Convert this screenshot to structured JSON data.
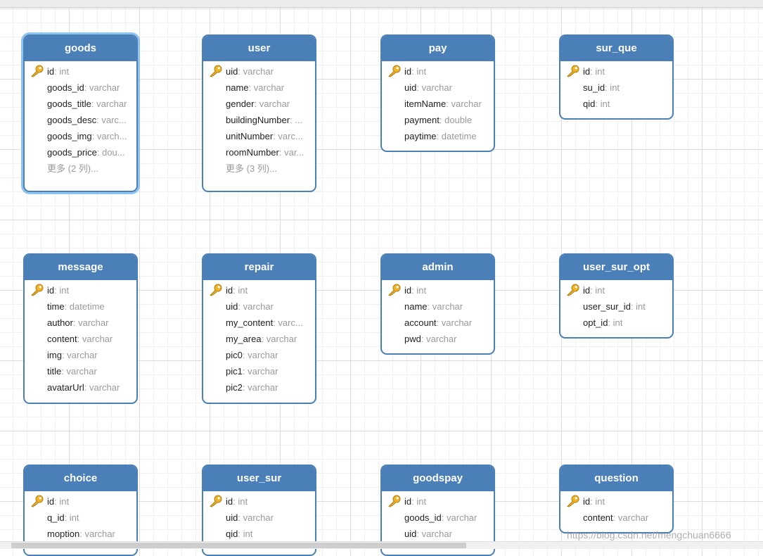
{
  "colors": {
    "header": "#4a7fb7",
    "type_text": "#9a9a9a",
    "key_icon": "#f0b428",
    "selection": "#8fc4f0"
  },
  "toolbar": {
    "status": ""
  },
  "tables": [
    {
      "name": "goods",
      "selected": true,
      "columns": [
        {
          "name": "id",
          "type": ": int",
          "pk": true
        },
        {
          "name": "goods_id",
          "type": ": varchar"
        },
        {
          "name": "goods_title",
          "type": ": varchar"
        },
        {
          "name": "goods_desc",
          "type": ": varc..."
        },
        {
          "name": "goods_img",
          "type": ": varch..."
        },
        {
          "name": "goods_price",
          "type": ": dou..."
        }
      ],
      "more": "更多 (2 列)..."
    },
    {
      "name": "user",
      "columns": [
        {
          "name": "uid",
          "type": ": varchar",
          "pk": true
        },
        {
          "name": "name",
          "type": ": varchar"
        },
        {
          "name": "gender",
          "type": ": varchar"
        },
        {
          "name": "buildingNumber",
          "type": ": ..."
        },
        {
          "name": "unitNumber",
          "type": ": varc..."
        },
        {
          "name": "roomNumber",
          "type": ": var..."
        }
      ],
      "more": "更多 (3 列)..."
    },
    {
      "name": "pay",
      "columns": [
        {
          "name": "id",
          "type": ": int",
          "pk": true
        },
        {
          "name": "uid",
          "type": ": varchar"
        },
        {
          "name": "itemName",
          "type": ": varchar"
        },
        {
          "name": "payment",
          "type": ": double"
        },
        {
          "name": "paytime",
          "type": ": datetime"
        }
      ]
    },
    {
      "name": "sur_que",
      "columns": [
        {
          "name": "id",
          "type": ": int",
          "pk": true
        },
        {
          "name": "su_id",
          "type": ": int"
        },
        {
          "name": "qid",
          "type": ": int"
        }
      ]
    },
    {
      "name": "message",
      "columns": [
        {
          "name": "id",
          "type": ": int",
          "pk": true
        },
        {
          "name": "time",
          "type": ": datetime"
        },
        {
          "name": "author",
          "type": ": varchar"
        },
        {
          "name": "content",
          "type": ": varchar"
        },
        {
          "name": "img",
          "type": ": varchar"
        },
        {
          "name": "title",
          "type": ": varchar"
        },
        {
          "name": "avatarUrl",
          "type": ": varchar"
        }
      ]
    },
    {
      "name": "repair",
      "columns": [
        {
          "name": "id",
          "type": ": int",
          "pk": true
        },
        {
          "name": "uid",
          "type": ": varchar"
        },
        {
          "name": "my_content",
          "type": ": varc..."
        },
        {
          "name": "my_area",
          "type": ": varchar"
        },
        {
          "name": "pic0",
          "type": ": varchar"
        },
        {
          "name": "pic1",
          "type": ": varchar"
        },
        {
          "name": "pic2",
          "type": ": varchar"
        }
      ]
    },
    {
      "name": "admin",
      "columns": [
        {
          "name": "id",
          "type": ": int",
          "pk": true
        },
        {
          "name": "name",
          "type": ": varchar"
        },
        {
          "name": "account",
          "type": ": varchar"
        },
        {
          "name": "pwd",
          "type": ": varchar"
        }
      ]
    },
    {
      "name": "user_sur_opt",
      "columns": [
        {
          "name": "id",
          "type": ": int",
          "pk": true
        },
        {
          "name": "user_sur_id",
          "type": ": int"
        },
        {
          "name": "opt_id",
          "type": ": int"
        }
      ]
    },
    {
      "name": "choice",
      "columns": [
        {
          "name": "id",
          "type": ": int",
          "pk": true
        },
        {
          "name": "q_id",
          "type": ": int"
        },
        {
          "name": "moption",
          "type": ": varchar"
        }
      ]
    },
    {
      "name": "user_sur",
      "columns": [
        {
          "name": "id",
          "type": ": int",
          "pk": true
        },
        {
          "name": "uid",
          "type": ": varchar"
        },
        {
          "name": "qid",
          "type": ": int"
        }
      ]
    },
    {
      "name": "goodspay",
      "columns": [
        {
          "name": "id",
          "type": ": int",
          "pk": true
        },
        {
          "name": "goods_id",
          "type": ": varchar"
        },
        {
          "name": "uid",
          "type": ": varchar"
        }
      ]
    },
    {
      "name": "question",
      "columns": [
        {
          "name": "id",
          "type": ": int",
          "pk": true
        },
        {
          "name": "content",
          "type": ": varchar"
        }
      ]
    }
  ],
  "watermark": "https://blog.csdn.net/mengchuan6666"
}
